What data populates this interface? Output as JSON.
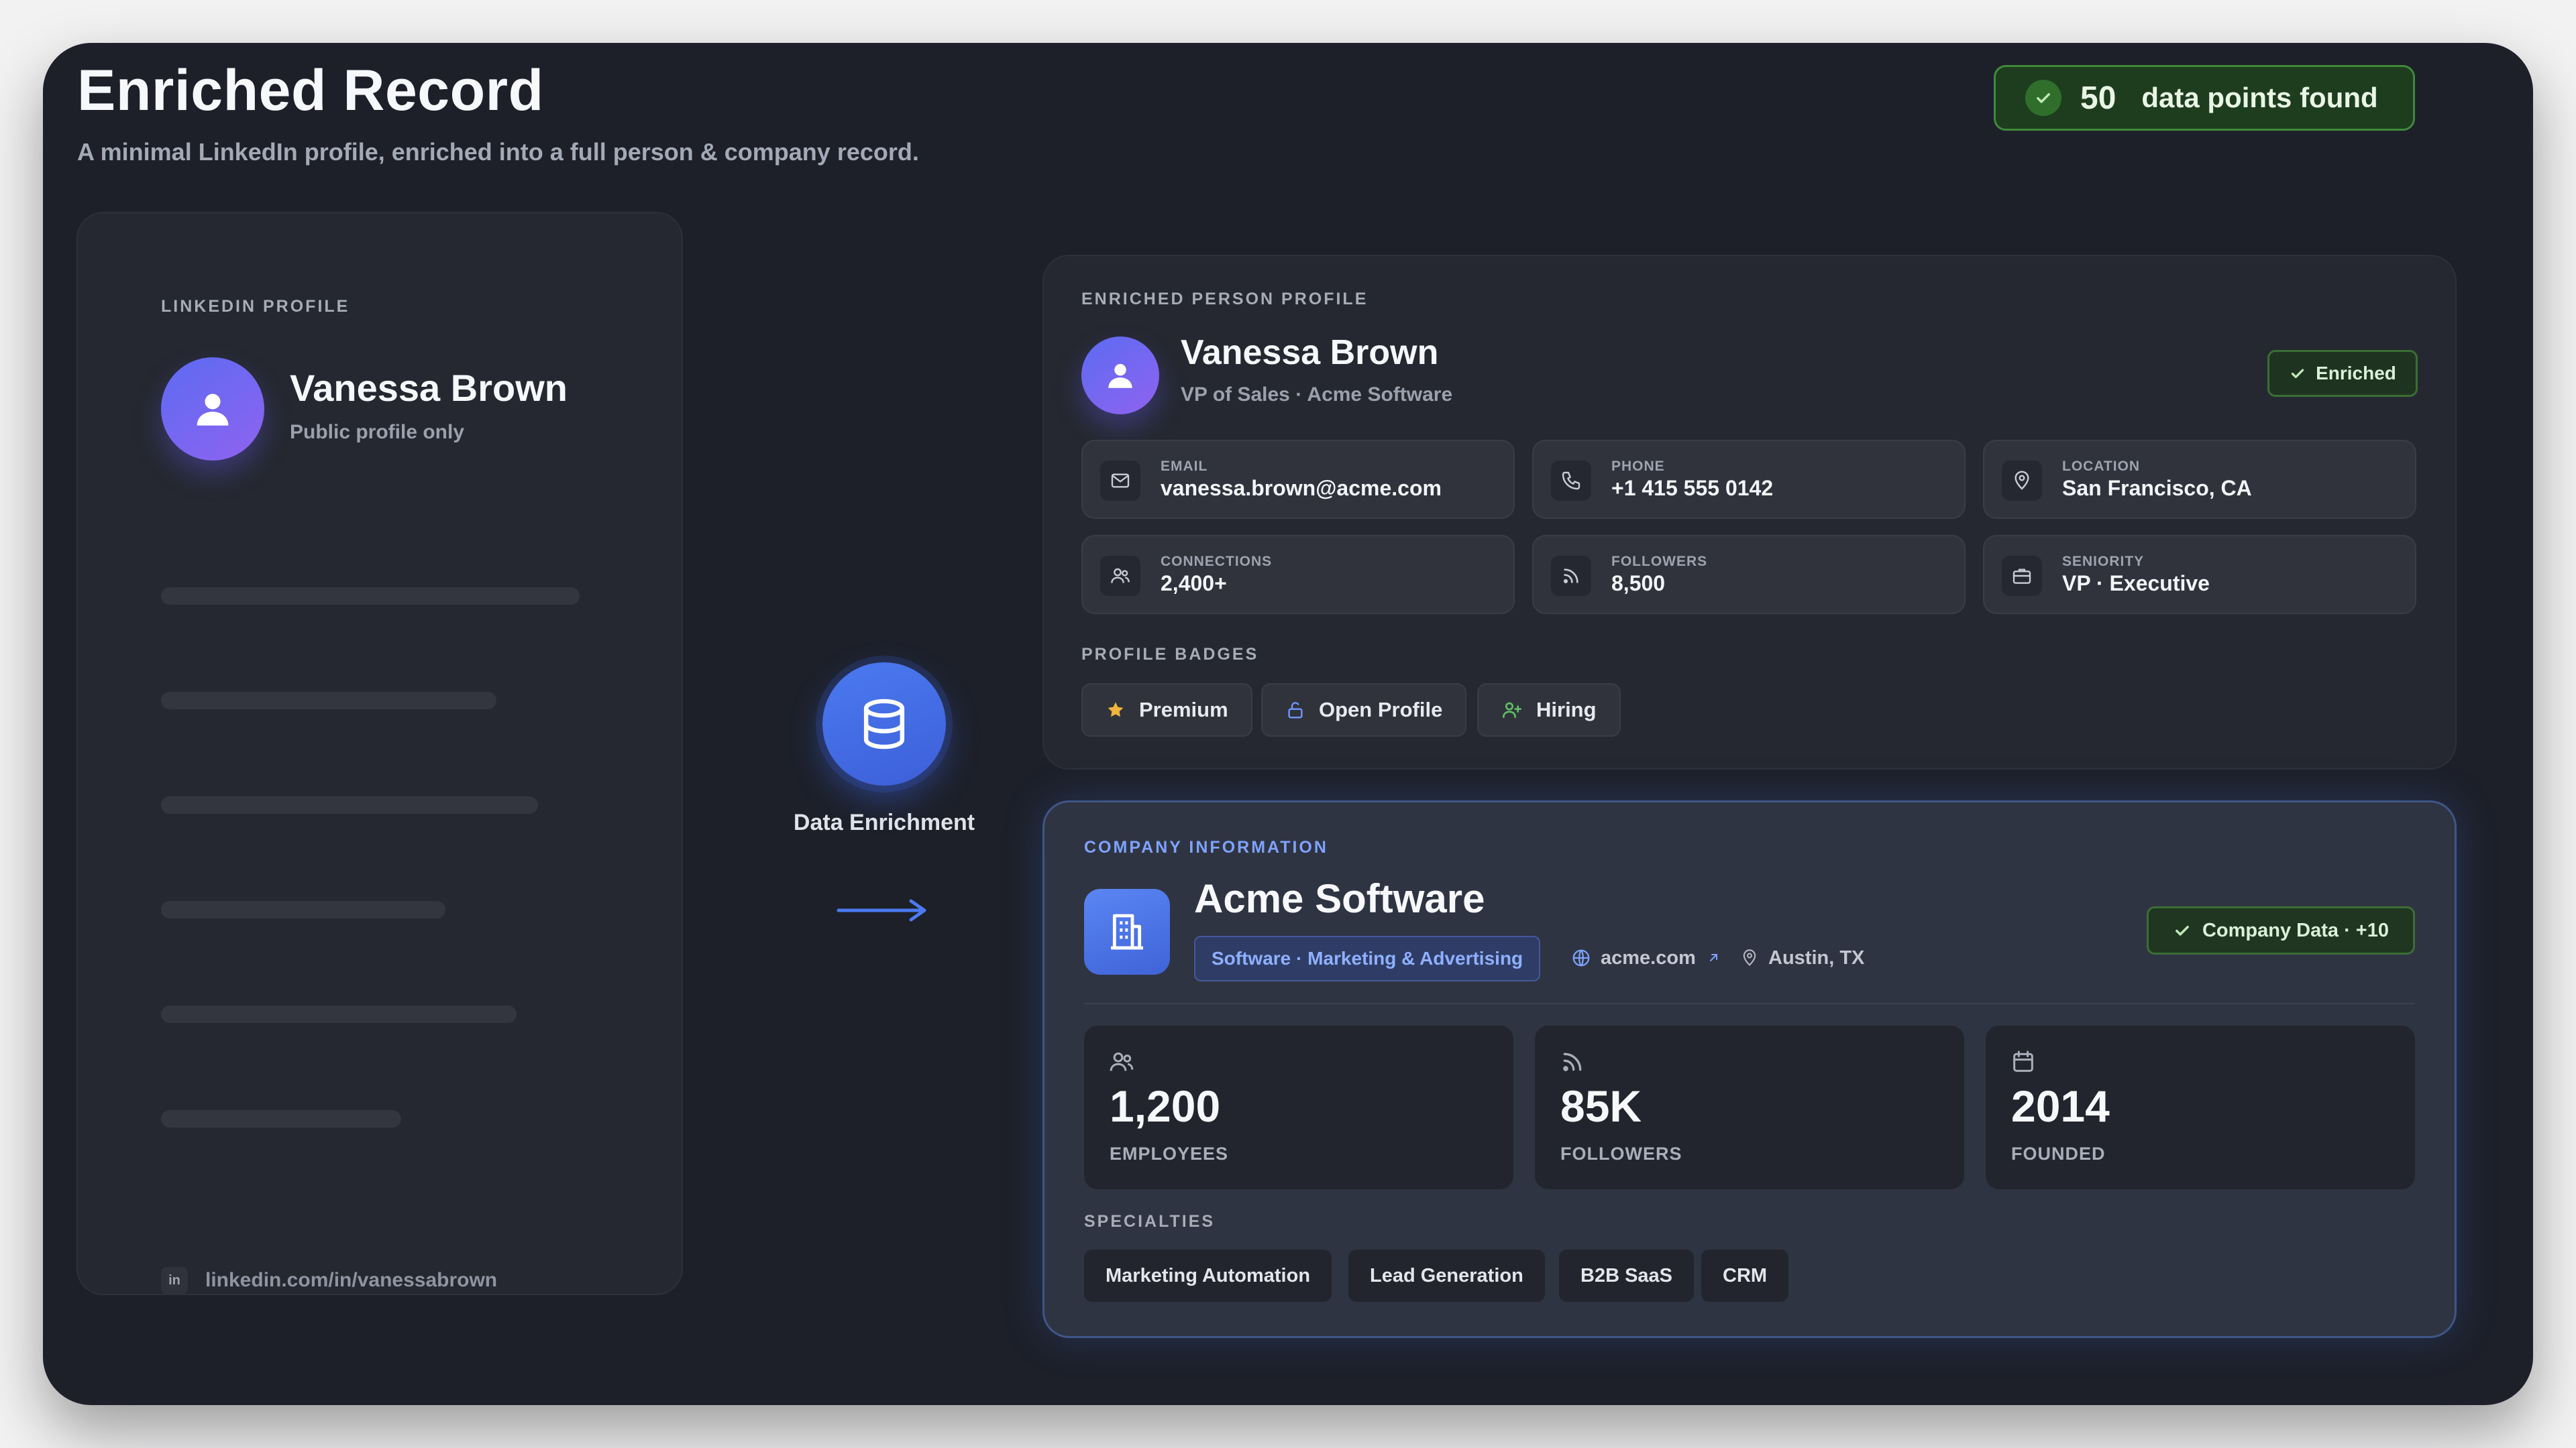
{
  "header": {
    "title": "Enriched Record",
    "subtitle": "A minimal LinkedIn profile, enriched into a full person & company record.",
    "found_count": "50",
    "found_text": "data points found"
  },
  "linkedin": {
    "label": "LINKEDIN PROFILE",
    "name": "Vanessa Brown",
    "sub": "Public profile only",
    "url_icon": "in",
    "url": "linkedin.com/in/vanessabrown"
  },
  "enrichment": {
    "label": "Data Enrichment"
  },
  "person": {
    "label": "ENRICHED PERSON PROFILE",
    "name": "Vanessa Brown",
    "role": "VP of Sales · Acme Software",
    "status": "Enriched",
    "fields": [
      {
        "key": "EMAIL",
        "value": "vanessa.brown@acme.com",
        "icon": "mail-icon"
      },
      {
        "key": "PHONE",
        "value": "+1 415 555 0142",
        "icon": "phone-icon"
      },
      {
        "key": "LOCATION",
        "value": "San Francisco, CA",
        "icon": "location-icon"
      },
      {
        "key": "CONNECTIONS",
        "value": "2,400+",
        "icon": "users-icon"
      },
      {
        "key": "FOLLOWERS",
        "value": "8,500",
        "icon": "rss-icon"
      },
      {
        "key": "SENIORITY",
        "value": "VP · Executive",
        "icon": "briefcase-icon"
      }
    ],
    "badges_label": "PROFILE BADGES",
    "badges": [
      {
        "label": "Premium",
        "icon": "star-icon"
      },
      {
        "label": "Open Profile",
        "icon": "unlock-icon"
      },
      {
        "label": "Hiring",
        "icon": "user-plus-icon"
      }
    ]
  },
  "company": {
    "label": "COMPANY INFORMATION",
    "name": "Acme Software",
    "industry": "Software · Marketing & Advertising",
    "website": "acme.com",
    "location": "Austin, TX",
    "status": "Company Data · +10",
    "stats": [
      {
        "value": "1,200",
        "key": "EMPLOYEES",
        "icon": "users-icon"
      },
      {
        "value": "85K",
        "key": "FOLLOWERS",
        "icon": "rss-icon"
      },
      {
        "value": "2014",
        "key": "FOUNDED",
        "icon": "calendar-icon"
      }
    ],
    "specialties_label": "SPECIALTIES",
    "specialties": [
      "Marketing Automation",
      "Lead Generation",
      "B2B SaaS",
      "CRM"
    ]
  },
  "colors": {
    "accent": "#4b7af0",
    "success": "#3f8a3a",
    "avatar": "#7a67f1",
    "star": "#f0b63a"
  }
}
